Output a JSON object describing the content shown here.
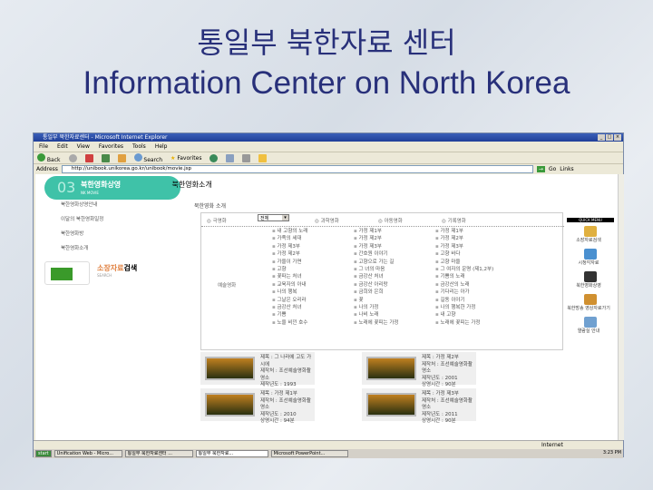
{
  "slide": {
    "title_ko": "통일부 북한자료 센터",
    "title_en": "Information Center on North Korea"
  },
  "browser": {
    "title": "통일부 북한자료센터 - Microsoft Internet Explorer",
    "menu": [
      "File",
      "Edit",
      "View",
      "Favorites",
      "Tools",
      "Help"
    ],
    "toolbar": {
      "back": "Back",
      "search": "Search",
      "favorites": "Favorites"
    },
    "address_label": "Address",
    "url": "http://unibook.unikorea.go.kr/unibook/movie.jsp",
    "go": "Go",
    "links": "Links",
    "status": "Internet"
  },
  "page": {
    "banner": {
      "number": "03",
      "title": "북한영화상영",
      "subtitle": "NK MOVIE"
    },
    "left_nav": [
      "북한영화상영안내",
      "이달의 북한영화일정",
      "북한영화방",
      "북한영화소개"
    ],
    "search_banner": {
      "title_a": "소장자료",
      "title_b": "검색",
      "subtitle": "SEARCH"
    },
    "section_title": "북한영화소개",
    "sub_title": "북한영화 소개",
    "categories": [
      "극영화",
      "과학영화",
      "아동영화",
      "기록영화"
    ],
    "select_value": "전체",
    "row_label": "예술영화",
    "movies": [
      [
        "내 고향의 노래",
        "가족의 세대",
        "가정 제3부",
        "가정 제2부",
        "가을이 가면",
        "고향",
        "꽃파는 처녀",
        "교육자의 아내",
        "나의 행복",
        "그날은 오리라",
        "금강산 처녀",
        "기쁨",
        "노을 비낀 호수"
      ],
      [
        "가정 제1부",
        "가정 제2부",
        "가정 제3부",
        "간호원 이야기",
        "고향으로 가는 길",
        "그 녀의 마음",
        "금강산 처녀",
        "금강산 아리랑",
        "금희와 은희",
        "꽃",
        "나의 가정",
        "나비 노래",
        "노래에 꽃피는 가정"
      ],
      [
        "가정 제1부",
        "가정 제2부",
        "가정 제3부",
        "고향 바다",
        "고향 마을",
        "그 여자의 운명 (제1,2부)",
        "기쁨의 노래",
        "금강산의 노래",
        "기다리는 아가",
        "길동 이야기",
        "나의 행복한 가정",
        "내 고향",
        "노래에 꽃피는 가정"
      ]
    ],
    "cards": [
      {
        "title": "제목 : 그 나라에 고도 가시에",
        "maker": "제작처 : 조선예술영화촬영소",
        "year": "제작년도 : 1993",
        "time": "상영시간 : 100"
      },
      {
        "title": "제목 : 가정 제2부",
        "maker": "제작처 : 조선예술영화촬영소",
        "year": "제작년도 : 2001",
        "time": "상영시간 : 90분"
      },
      {
        "title": "제목 : 가정 제1부",
        "maker": "제작처 : 조선예술영화촬영소",
        "year": "제작년도 : 2010",
        "time": "상영시간 : 94분"
      },
      {
        "title": "제목 : 가정 제3부",
        "maker": "제작처 : 조선예술영화촬영소",
        "year": "제작년도 : 2011",
        "time": "상영시간 : 90분"
      }
    ],
    "right_panel": {
      "header": "QUICK MENU",
      "items": [
        "소장자료검색",
        "시청각자료",
        "북한영화상영",
        "북한방송 영상자료가기",
        "열람실 안내"
      ]
    }
  },
  "taskbar": {
    "start": "start",
    "items": [
      "Unification Web - Micro...",
      "통일부 북한자료센터 ...",
      "통일부 북한자료...",
      "Microsoft PowerPoint..."
    ],
    "clock": "3:23 PM"
  }
}
